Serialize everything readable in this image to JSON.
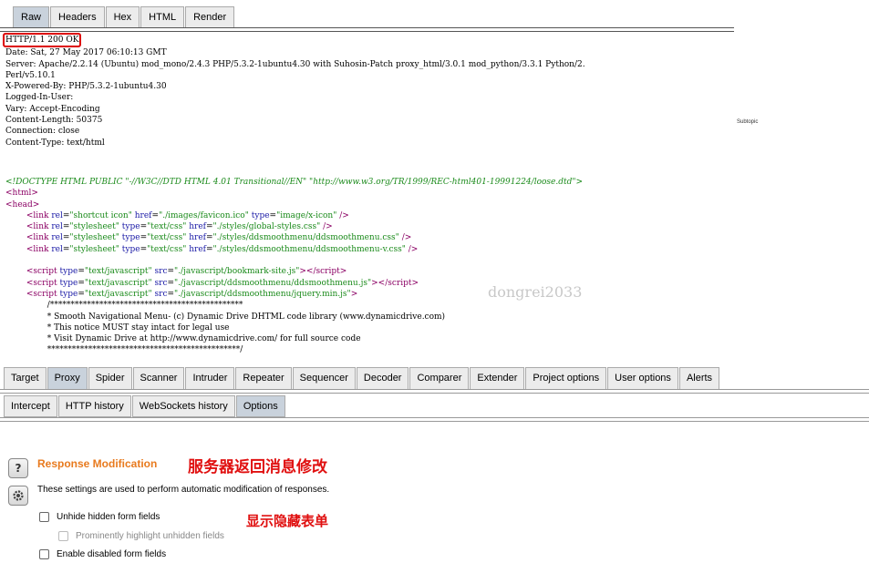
{
  "viewer": {
    "tabs": [
      "Raw",
      "Headers",
      "Hex",
      "HTML",
      "Render"
    ],
    "active_tab": "Raw",
    "status_line": "HTTP/1.1 200 OK",
    "headers": [
      "Date: Sat, 27 May 2017 06:10:13 GMT",
      "Server: Apache/2.2.14 (Ubuntu) mod_mono/2.4.3 PHP/5.3.2-1ubuntu4.30 with Suhosin-Patch proxy_html/3.0.1 mod_python/3.3.1 Python/2.",
      "Perl/v5.10.1",
      "X-Powered-By: PHP/5.3.2-1ubuntu4.30",
      "Logged-In-User:",
      "Vary: Accept-Encoding",
      "Content-Length: 50375",
      "Connection: close",
      "Content-Type: text/html"
    ],
    "subtopic": "Subtopic",
    "watermark": "dongrei2033",
    "body": {
      "doctype": "<!DOCTYPE HTML PUBLIC \"-//W3C//DTD HTML 4.01 Transitional//EN\" \"http://www.w3.org/TR/1999/REC-html401-19991224/loose.dtd\">",
      "html_open": "<html>",
      "head_open": "<head>",
      "links": [
        {
          "rel": "\"shortcut icon\"",
          "href": "\"./images/favicon.ico\"",
          "type": "\"image/x-icon\""
        },
        {
          "rel": "\"stylesheet\"",
          "type": "\"text/css\"",
          "href": "\"./styles/global-styles.css\""
        },
        {
          "rel": "\"stylesheet\"",
          "type": "\"text/css\"",
          "href": "\"./styles/ddsmoothmenu/ddsmoothmenu.css\""
        },
        {
          "rel": "\"stylesheet\"",
          "type": "\"text/css\"",
          "href": "\"./styles/ddsmoothmenu/ddsmoothmenu-v.css\""
        }
      ],
      "scripts": [
        "\"./javascript/bookmark-site.js\"",
        "\"./javascript/ddsmoothmenu/ddsmoothmenu.js\"",
        "\"./javascript/ddsmoothmenu/jquery.min.js\""
      ],
      "comment_lines": [
        "/***********************************************",
        "* Smooth Navigational Menu- (c) Dynamic Drive DHTML code library (www.dynamicdrive.com)",
        "* This notice MUST stay intact for legal use",
        "* Visit Dynamic Drive at http://www.dynamicdrive.com/ for full source code",
        "***********************************************/"
      ]
    }
  },
  "main_tabs": [
    "Target",
    "Proxy",
    "Spider",
    "Scanner",
    "Intruder",
    "Repeater",
    "Sequencer",
    "Decoder",
    "Comparer",
    "Extender",
    "Project options",
    "User options",
    "Alerts"
  ],
  "active_main_tab": "Proxy",
  "sub_tabs": [
    "Intercept",
    "HTTP history",
    "WebSockets history",
    "Options"
  ],
  "active_sub_tab": "Options",
  "options": {
    "help_icon": "?",
    "section_title": "Response Modification",
    "description": "These settings are used to perform automatic modification of responses.",
    "checkboxes": [
      {
        "label": "Unhide hidden form fields",
        "checked": false,
        "enabled": true
      },
      {
        "label": "Prominently highlight unhidden fields",
        "checked": false,
        "enabled": false
      },
      {
        "label": "Enable disabled form fields",
        "checked": false,
        "enabled": true
      }
    ]
  },
  "annotations": {
    "title_note": "服务器返回消息修改",
    "unhide_note": "显示隐藏表单"
  },
  "colors": {
    "section_title": "#e87a1e",
    "annotation": "#e01010",
    "status_box": "#dd0000"
  }
}
